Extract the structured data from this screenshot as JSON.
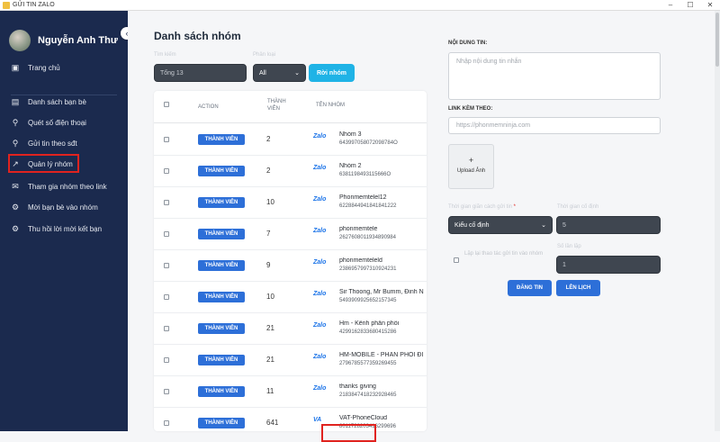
{
  "window": {
    "title": "GỬI TIN ZALO"
  },
  "sidebar": {
    "user_name": "Nguyễn Anh Thư",
    "items": [
      {
        "label": "Trang chủ",
        "icon": "chart-icon"
      },
      {
        "label": "Danh sách bạn bè",
        "icon": "user-list-icon"
      },
      {
        "label": "Quét số điện thoại",
        "icon": "search-icon"
      },
      {
        "label": "Gửi tin theo sđt",
        "icon": "phone-search-icon"
      },
      {
        "label": "Quản lý nhóm",
        "icon": "trend-icon"
      },
      {
        "label": "Tham gia nhóm theo link",
        "icon": "mail-icon"
      },
      {
        "label": "Mời bạn bè vào nhóm",
        "icon": "settings-icon"
      },
      {
        "label": "Thu hồi lời mời kết bạn",
        "icon": "settings-icon"
      }
    ]
  },
  "main": {
    "title": "Danh sách nhóm",
    "filters": {
      "label_total": "Tìm kiếm",
      "total_value": "Tổng 13",
      "label_select": "Phân loại",
      "select_value": "All",
      "leave_button": "Rời nhóm"
    },
    "table": {
      "headers": {
        "action": "ACTION",
        "members_line1": "THÀNH",
        "members_line2": "VIÊN",
        "group_name": "TÊN NHÓM"
      },
      "member_button": "THÀNH VIÊN",
      "rows": [
        {
          "count": "2",
          "logo": "Zalo",
          "name": "Nhóm 3",
          "id": "643997058072098784O"
        },
        {
          "count": "2",
          "logo": "Zalo",
          "name": "Nhóm 2",
          "id": "6381198493115666O"
        },
        {
          "count": "10",
          "logo": "Zalo",
          "name": "Phonmemtelel12",
          "id": "6228844941841841222"
        },
        {
          "count": "7",
          "logo": "Zalo",
          "name": "phonmemtele",
          "id": "2627608011934890984"
        },
        {
          "count": "9",
          "logo": "Zalo",
          "name": "phonmemteleld",
          "id": "2386957997310924231"
        },
        {
          "count": "10",
          "logo": "Zalo",
          "name": "Sir Thoong, Mr Bumm, Đinh N",
          "id": "5493909925652157345"
        },
        {
          "count": "21",
          "logo": "Zalo",
          "name": "Hm - Kênh phân phối",
          "id": "4299162833680415286"
        },
        {
          "count": "21",
          "logo": "Zalo",
          "name": "HM-MOBILE - PHÂN PHỐI ĐI",
          "id": "2796785577359269455"
        },
        {
          "count": "11",
          "logo": "Zalo",
          "name": "thanks giving",
          "id": "2183847418232928465"
        },
        {
          "count": "641",
          "logo": "VA",
          "name": "VAT-PhoneCloud",
          "id": "8011728203416299696"
        }
      ]
    }
  },
  "compose": {
    "content_label": "NỘI DUNG TIN:",
    "content_placeholder": "Nhập nội dung tin nhắn",
    "link_label": "LINK KÈM THEO:",
    "link_placeholder": "https://phonmemninja.com",
    "upload_plus": "+",
    "upload_label": "Upload Ảnh",
    "interval_type_label": "Thời gian giãn cách gửi tin",
    "interval_type_required": "*",
    "interval_type_value": "Kiểu cố định",
    "interval_seconds_label": "Thời gian cố định",
    "interval_seconds_value": "5",
    "repeat_label": "Số lần lặp",
    "repeat_value": "1",
    "repeat_check_label": "Lặp lại thao tác gửi tin vào nhóm",
    "post_button": "ĐĂNG TIN",
    "schedule_button": "LÊN LỊCH"
  }
}
